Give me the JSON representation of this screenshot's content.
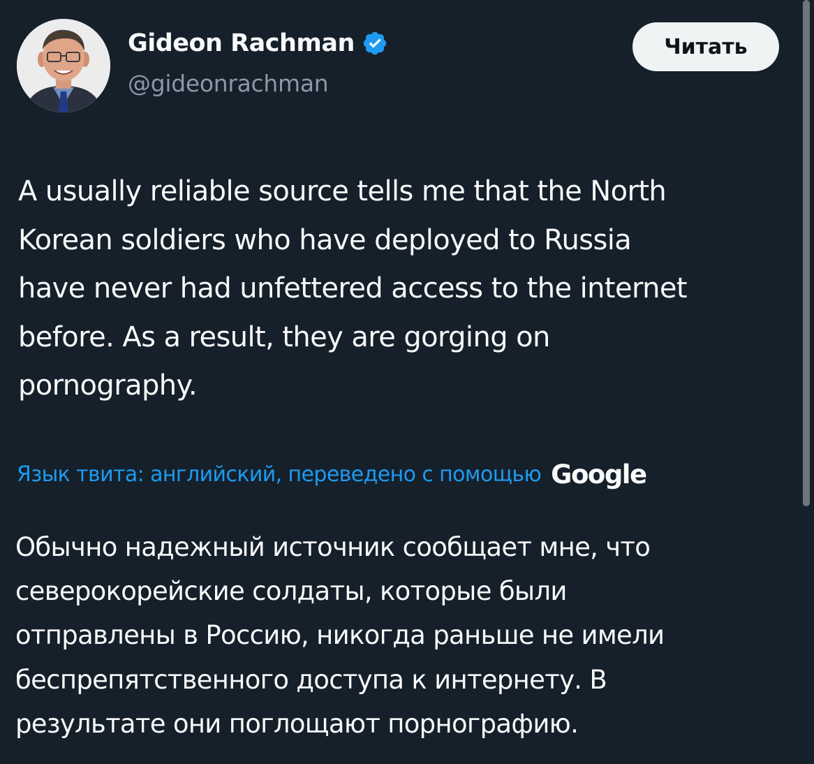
{
  "author": {
    "display_name": "Gideon Rachman",
    "handle": "@gideonrachman",
    "verified": true,
    "verified_badge_color": "#1d9bf0"
  },
  "follow_button": {
    "label": "Читать"
  },
  "tweet": {
    "text": "A usually reliable source tells me that the North\nKorean soldiers who have deployed to Russia\nhave never had unfettered access to the internet\nbefore. As a result, they are gorging on\npornography."
  },
  "translation": {
    "label": "Язык твита: английский, переведено с помощью",
    "provider": "Google",
    "text": "Обычно надежный источник сообщает мне, что\nсеверокорейские солдаты, которые были\nотправлены в Россию, никогда раньше не имели\nбеспрепятственного доступа к интернету. В\nрезультате они поглощают порнографию."
  },
  "colors": {
    "background": "#15202b",
    "primary_text": "#f7f9f9",
    "secondary_text": "#8b98a5",
    "link": "#1d9bf0",
    "button_bg": "#eff3f4"
  }
}
